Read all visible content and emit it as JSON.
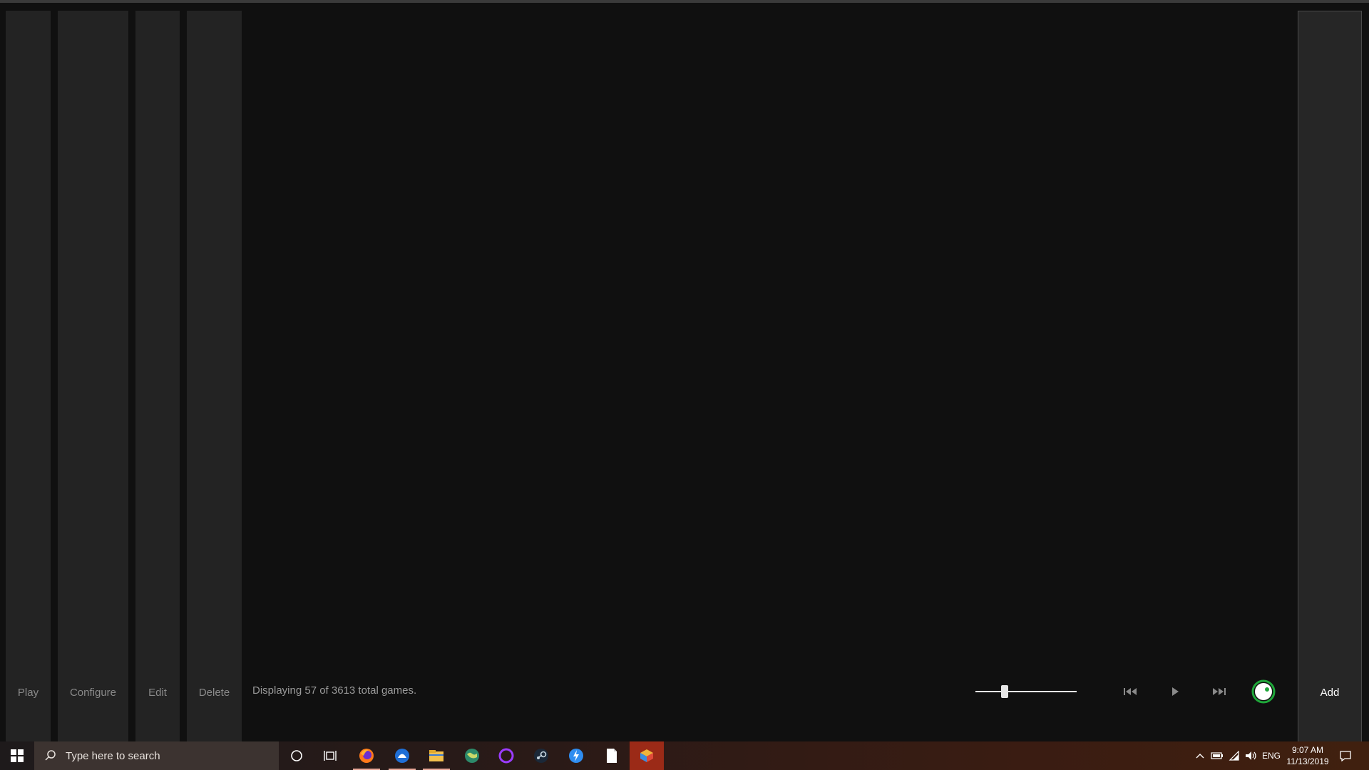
{
  "toolbar": {
    "play_label": "Play",
    "configure_label": "Configure",
    "edit_label": "Edit",
    "delete_label": "Delete",
    "add_label": "Add"
  },
  "status_text": "Displaying 57 of 3613 total games.",
  "zoom_slider": {
    "value_fraction": 0.27
  },
  "media": {
    "previous_icon": "skip-previous-icon",
    "play_icon": "play-icon",
    "next_icon": "skip-next-icon"
  },
  "colors": {
    "background": "#101010",
    "panel": "#232323",
    "accent_green": "#1fa83a",
    "taskbar_active": "#9b2a17"
  },
  "taskbar": {
    "search_placeholder": "Type here to search",
    "pinned": [
      "firefox-icon",
      "app-blue-icon",
      "file-explorer-icon",
      "globe-app-icon",
      "ring-app-icon",
      "steam-icon",
      "messenger-icon",
      "document-icon",
      "cube-app-icon"
    ],
    "language": "ENG",
    "time": "9:07 AM",
    "date": "11/13/2019"
  }
}
